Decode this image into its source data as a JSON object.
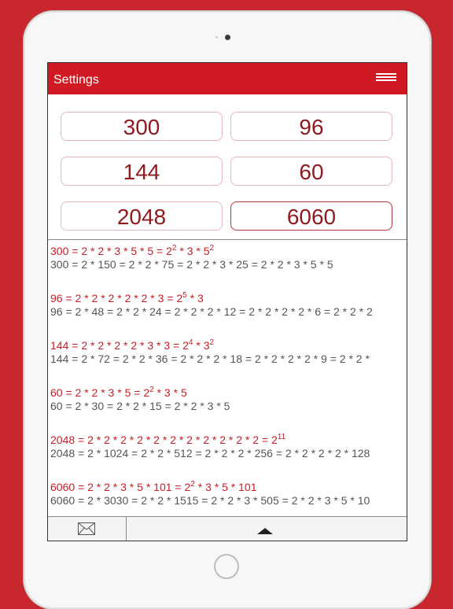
{
  "header": {
    "title": "Settings",
    "menu_icon": "hamburger-icon"
  },
  "inputs": [
    "300",
    "96",
    "144",
    "60",
    "2048",
    "6060"
  ],
  "results": [
    {
      "factor_base": "300 = 2 * 2 * 3 * 5 * 5 = ",
      "factor_terms": [
        [
          "2",
          "2"
        ],
        [
          "3",
          ""
        ],
        [
          "5",
          "2"
        ]
      ],
      "chain": "300 = 2 * 150 = 2 * 2 * 75 = 2 * 2 * 3 * 25 = 2 * 2 * 3 * 5 * 5"
    },
    {
      "factor_base": "96 = 2 * 2 * 2 * 2 * 2 * 3 = ",
      "factor_terms": [
        [
          "2",
          "5"
        ],
        [
          "3",
          ""
        ]
      ],
      "chain": "96 = 2 * 48 = 2 * 2 * 24 = 2 * 2 * 2 * 12 = 2 * 2 * 2 * 2 * 6 = 2 * 2 * 2"
    },
    {
      "factor_base": "144 = 2 * 2 * 2 * 2 * 3 * 3 = ",
      "factor_terms": [
        [
          "2",
          "4"
        ],
        [
          "3",
          "2"
        ]
      ],
      "chain": "144 = 2 * 72 = 2 * 2 * 36 = 2 * 2 * 2 * 18 = 2 * 2 * 2 * 2 * 9 = 2 * 2 *"
    },
    {
      "factor_base": "60 = 2 * 2 * 3 * 5 = ",
      "factor_terms": [
        [
          "2",
          "2"
        ],
        [
          "3",
          ""
        ],
        [
          "5",
          ""
        ]
      ],
      "chain": "60 = 2 * 30 = 2 * 2 * 15 = 2 * 2 * 3 * 5"
    },
    {
      "factor_base": "2048 = 2 * 2 * 2 * 2 * 2 * 2 * 2 * 2 * 2 * 2 * 2 = ",
      "factor_terms": [
        [
          "2",
          "11"
        ]
      ],
      "chain": "2048 = 2 * 1024 = 2 * 2 * 512 = 2 * 2 * 2 * 256 = 2 * 2 * 2 * 2 * 128"
    },
    {
      "factor_base": "6060 = 2 * 2 * 3 * 5 * 101 = ",
      "factor_terms": [
        [
          "2",
          "2"
        ],
        [
          "3",
          ""
        ],
        [
          "5",
          ""
        ],
        [
          "101",
          ""
        ]
      ],
      "chain": "6060 = 2 * 3030 = 2 * 2 * 1515 = 2 * 2 * 3 * 505 = 2 * 2 * 3 * 5 * 10"
    }
  ],
  "toolbar": {
    "mail_icon": "mail-icon",
    "scroll_icon": "triangle-up-icon"
  },
  "colors": {
    "brand_red": "#d11923",
    "background_red": "#c8282d",
    "factor_text": "#c41e26",
    "number_text": "#8f1a20"
  }
}
